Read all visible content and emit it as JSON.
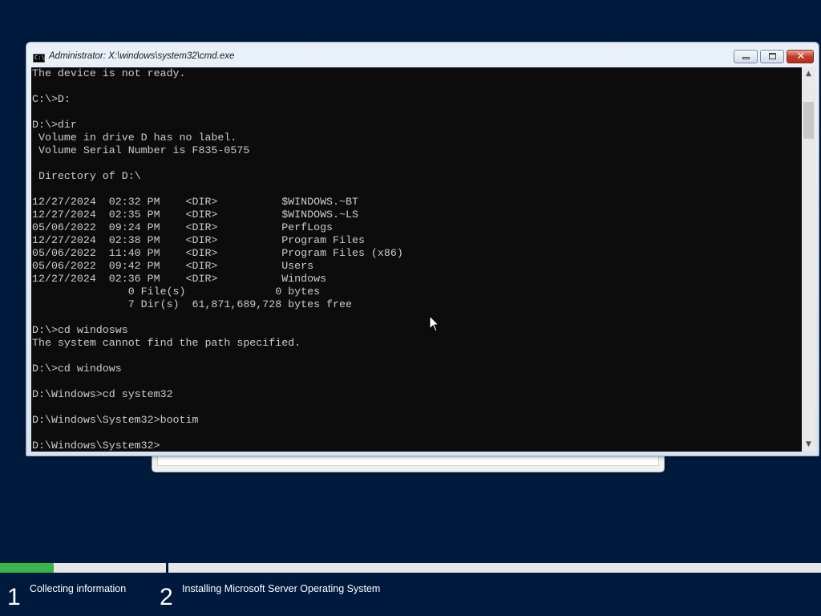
{
  "window": {
    "title": "Administrator: X:\\windows\\system32\\cmd.exe",
    "icon_text": "C:\\",
    "close_glyph": "✕"
  },
  "console": {
    "lines": [
      "The device is not ready.",
      "",
      "C:\\>D:",
      "",
      "D:\\>dir",
      " Volume in drive D has no label.",
      " Volume Serial Number is F835-0575",
      "",
      " Directory of D:\\",
      "",
      "12/27/2024  02:32 PM    <DIR>          $WINDOWS.~BT",
      "12/27/2024  02:35 PM    <DIR>          $WINDOWS.~LS",
      "05/06/2022  09:24 PM    <DIR>          PerfLogs",
      "12/27/2024  02:38 PM    <DIR>          Program Files",
      "05/06/2022  11:40 PM    <DIR>          Program Files (x86)",
      "05/06/2022  09:42 PM    <DIR>          Users",
      "12/27/2024  02:36 PM    <DIR>          Windows",
      "               0 File(s)              0 bytes",
      "               7 Dir(s)  61,871,689,728 bytes free",
      "",
      "D:\\>cd windosws",
      "The system cannot find the path specified.",
      "",
      "D:\\>cd windows",
      "",
      "D:\\Windows>cd system32",
      "",
      "D:\\Windows\\System32>bootim",
      "",
      "D:\\Windows\\System32>"
    ]
  },
  "scrollbar": {
    "up_icon": "arrow-up-icon",
    "down_icon": "arrow-down-icon",
    "up_glyph": "▲",
    "down_glyph": "▼"
  },
  "setup": {
    "progress_fraction": 0.065,
    "progress_color": "#39b54a",
    "steps": [
      {
        "number": "1",
        "label": "Collecting information"
      },
      {
        "number": "2",
        "label": "Installing Microsoft Server Operating System"
      }
    ]
  },
  "colors": {
    "desktop_background": "#001a3d",
    "console_background": "#0c0c0c",
    "console_text": "#cccccc"
  }
}
